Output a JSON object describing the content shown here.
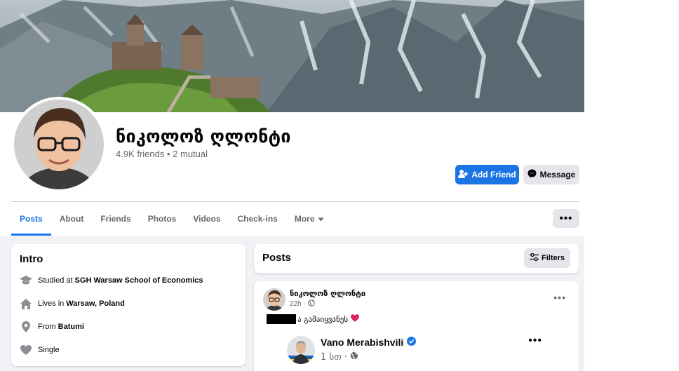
{
  "profile": {
    "name": "ნიკოლოზ ღლონტი",
    "friends_text": "4.9K friends • 2 mutual"
  },
  "actions": {
    "add_friend": "Add Friend",
    "message": "Message",
    "more": "•••"
  },
  "tabs": [
    {
      "label": "Posts",
      "active": true
    },
    {
      "label": "About"
    },
    {
      "label": "Friends"
    },
    {
      "label": "Photos"
    },
    {
      "label": "Videos"
    },
    {
      "label": "Check-ins"
    },
    {
      "label": "More"
    }
  ],
  "intro": {
    "title": "Intro",
    "items": [
      {
        "icon": "graduation-cap-icon",
        "prefix": "Studied at",
        "value": "SGH Warsaw School of Economics"
      },
      {
        "icon": "home-icon",
        "prefix": "Lives in",
        "value": "Warsaw, Poland"
      },
      {
        "icon": "location-pin-icon",
        "prefix": "From",
        "value": "Batumi"
      },
      {
        "icon": "heart-icon",
        "prefix": "Single",
        "value": ""
      }
    ]
  },
  "posts": {
    "title": "Posts",
    "filters": "Filters"
  },
  "post": {
    "author": "ნიკოლოზ ღლონტი",
    "time": "22h ·",
    "text": "ა გამაიყვანეს",
    "dots": "•••",
    "shared": {
      "author": "Vano Merabishvili",
      "time": "1 სთ ·",
      "dots": "•••"
    }
  },
  "colors": {
    "accent": "#1b74e4",
    "verified": "#1b74e4",
    "heart": "#e0245e"
  }
}
